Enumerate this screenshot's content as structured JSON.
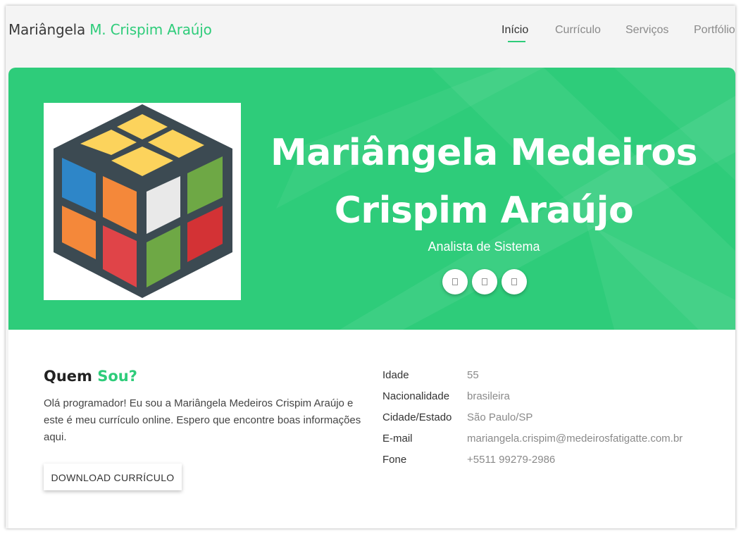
{
  "colors": {
    "accent": "#2ecc7a",
    "header_bg": "#f4f4f4",
    "text_dark": "#333333",
    "text_muted": "#8a8a8a"
  },
  "header": {
    "brand_first": "Mariângela",
    "brand_rest": "M. Crispim Araújo",
    "nav": [
      {
        "label": "Início",
        "active": true
      },
      {
        "label": "Currículo",
        "active": false
      },
      {
        "label": "Serviços",
        "active": false
      },
      {
        "label": "Portfólio",
        "active": false
      }
    ]
  },
  "hero": {
    "avatar_icon": "rubiks-cube-icon",
    "name_line1": "Mariângela Medeiros",
    "name_line2": "Crispim Araújo",
    "role": "Analista de Sistema",
    "socials": [
      "social-icon",
      "social-icon",
      "social-icon"
    ]
  },
  "about": {
    "title_first": "Quem",
    "title_accent": "Sou?",
    "text": "Olá programador! Eu sou a Mariângela Medeiros Crispim Araújo e este é meu currículo online. Espero que encontre boas informações aqui.",
    "download_label": "DOWNLOAD CURRÍCULO",
    "info": [
      {
        "label": "Idade",
        "value": "55"
      },
      {
        "label": "Nacionalidade",
        "value": "brasileira"
      },
      {
        "label": "Cidade/Estado",
        "value": "São Paulo/SP"
      },
      {
        "label": "E-mail",
        "value": "mariangela.crispim@medeirosfatigatte.com.br"
      },
      {
        "label": "Fone",
        "value": "+5511 99279-2986"
      }
    ]
  }
}
